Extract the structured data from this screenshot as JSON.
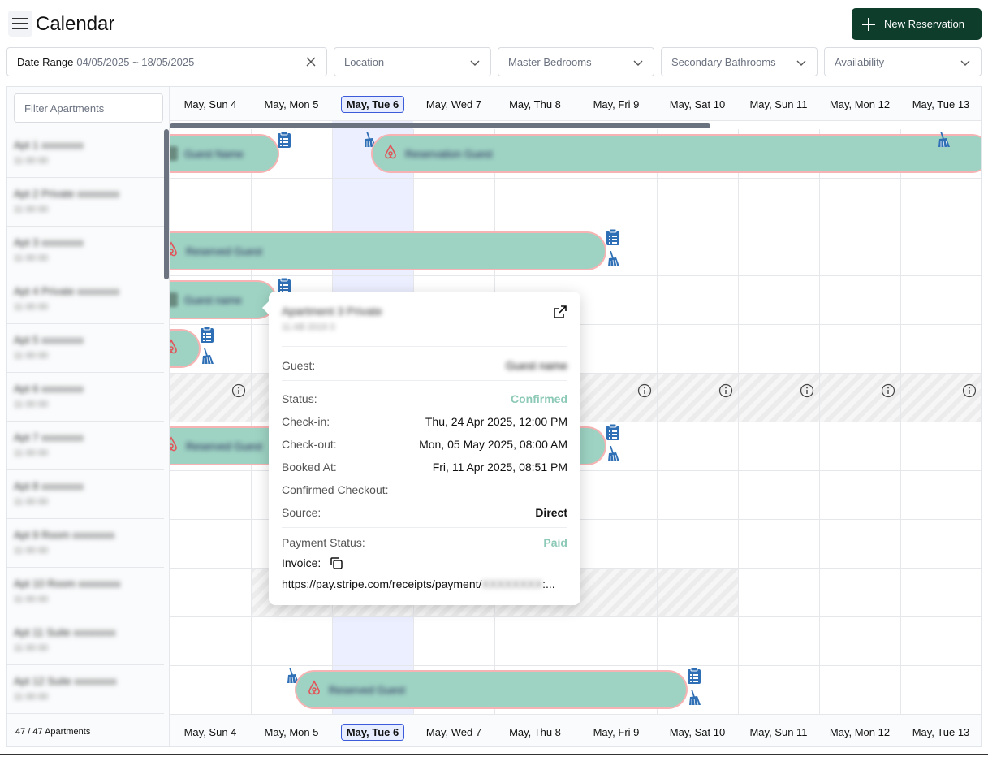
{
  "header": {
    "title": "Calendar",
    "new_button": "New Reservation"
  },
  "filters": {
    "date_range_label": "Date Range",
    "date_range_value": "04/05/2025 ~ 18/05/2025",
    "location": "Location",
    "master_bedrooms": "Master Bedrooms",
    "secondary_bathrooms": "Secondary Bathrooms",
    "availability": "Availability"
  },
  "sidebar": {
    "filter_placeholder": "Filter Apartments",
    "count": "47 / 47 Apartments"
  },
  "days": [
    "May, Sun 4",
    "May, Mon 5",
    "May, Tue 6",
    "May, Wed 7",
    "May, Thu 8",
    "May, Fri 9",
    "May, Sat 10",
    "May, Sun 11",
    "May, Mon 12",
    "May, Tue 13"
  ],
  "today_index": 2,
  "popover": {
    "guest_label": "Guest:",
    "status_label": "Status:",
    "status_value": "Confirmed",
    "checkin_label": "Check-in:",
    "checkin_value": "Thu, 24 Apr 2025, 12:00 PM",
    "checkout_label": "Check-out:",
    "checkout_value": "Mon, 05 May 2025, 08:00 AM",
    "booked_label": "Booked At:",
    "booked_value": "Fri, 11 Apr 2025, 08:51 PM",
    "confirmed_checkout_label": "Confirmed Checkout:",
    "confirmed_checkout_value": "—",
    "source_label": "Source:",
    "source_value": "Direct",
    "payment_status_label": "Payment Status:",
    "payment_status_value": "Paid",
    "invoice_label": "Invoice:",
    "invoice_url": "https://pay.stripe.com/receipts/payment/"
  },
  "colors": {
    "accent": "#0e3d2c",
    "booking_fill": "#9ed3c3",
    "booking_outline": "#f7b3b3",
    "today_highlight": "#dce2ff",
    "confirmed": "#8cc9b6",
    "icon_blue": "#2f6fb5"
  }
}
